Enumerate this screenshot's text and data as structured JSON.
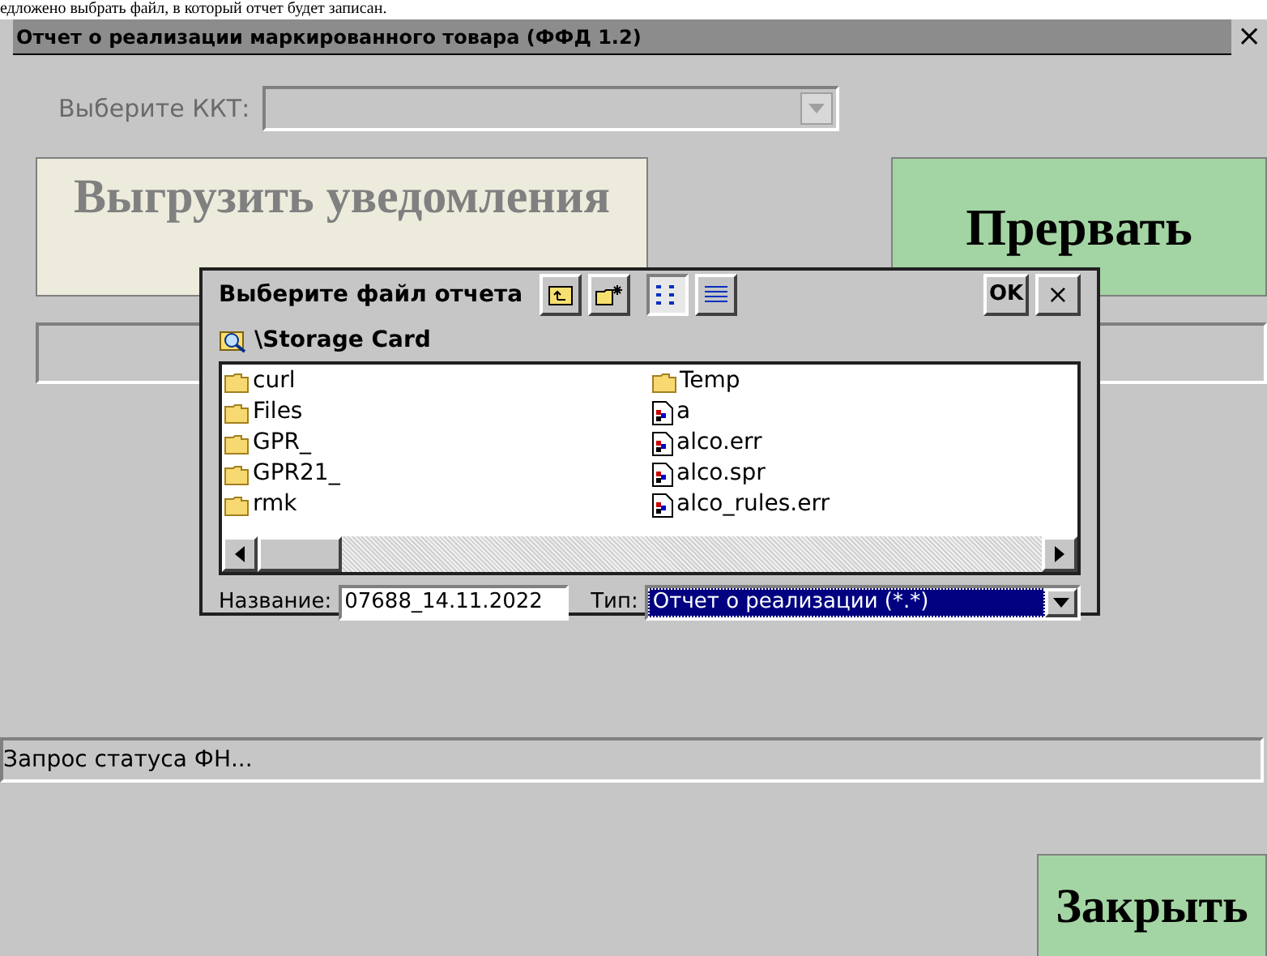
{
  "caption": "едложено выбрать файл, в который отчет будет записан.",
  "window": {
    "title": "Отчет о реализации маркированного товара (ФФД 1.2)",
    "close": "×"
  },
  "kkt": {
    "label": "Выберите ККТ:",
    "disabled": true
  },
  "upload_button": {
    "label": "Выгрузить уведомления",
    "disabled": true
  },
  "abort_button": {
    "label": "Прервать"
  },
  "dialog": {
    "title": "Выберите файл отчета",
    "ok": "OK",
    "close": "×",
    "path": "\\Storage Card",
    "columns": [
      [
        {
          "kind": "folder",
          "name": "curl"
        },
        {
          "kind": "folder",
          "name": "Files"
        },
        {
          "kind": "folder",
          "name": "GPR_"
        },
        {
          "kind": "folder",
          "name": "GPR21_"
        },
        {
          "kind": "folder",
          "name": "rmk"
        }
      ],
      [
        {
          "kind": "folder",
          "name": "Temp"
        },
        {
          "kind": "file",
          "name": "a"
        },
        {
          "kind": "file",
          "name": "alco.err"
        },
        {
          "kind": "file",
          "name": "alco.spr"
        },
        {
          "kind": "file",
          "name": "alco_rules.err"
        }
      ]
    ],
    "name_label": "Название:",
    "name_value": "07688_14.11.2022",
    "type_label": "Тип:",
    "type_value": "Отчет о реализации (*.*)"
  },
  "progress": {
    "level": 0
  },
  "status": "Запрос статуса ФН...",
  "close_button": {
    "label": "Закрыть"
  }
}
